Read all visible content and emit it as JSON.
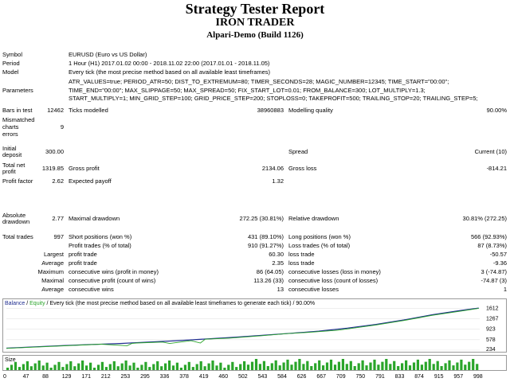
{
  "header": {
    "title": "Strategy Tester Report",
    "subtitle": "IRON TRADER",
    "server": "Alpari-Demo (Build 1126)"
  },
  "info": {
    "symbol_label": "Symbol",
    "symbol": "EURUSD (Euro vs US Dollar)",
    "period_label": "Period",
    "period": "1 Hour (H1) 2017.01.02 00:00 - 2018.11.02 22:00 (2017.01.01 - 2018.11.05)",
    "model_label": "Model",
    "model": "Every tick (the most precise method based on all available least timeframes)",
    "parameters_label": "Parameters",
    "parameters_line1": "ATR_VALUES=true; PERIOD_ATR=50; DIST_TO_EXTREMUM=80; TIMER_SECONDS=28; MAGIC_NUMBER=12345; TIME_START=\"00:00\";",
    "parameters_line2": "TIME_END=\"00:00\"; MAX_SLIPPAGE=50; MAX_SPREAD=50; FIX_START_LOT=0.01; FROM_BALANCE=300; LOT_MULTIPLY=1.3;",
    "parameters_line3": "START_MULTIPLY=1; MIN_GRID_STEP=100; GRID_PRICE_STEP=200; STOPLOSS=0; TAKEPROFIT=500; TRAILING_STOP=20; TRAILING_STEP=5;"
  },
  "stats": {
    "bars_label": "Bars in test",
    "bars": "12462",
    "ticks_label": "Ticks modelled",
    "ticks": "38960883",
    "quality_label": "Modelling quality",
    "quality": "90.00%",
    "mismatch_label1": "Mismatched",
    "mismatch_label2": "charts",
    "mismatch_label3": "errors",
    "mismatch": "9",
    "deposit_label1": "Initial",
    "deposit_label2": "deposit",
    "deposit": "300.00",
    "spread_label": "Spread",
    "spread": "Current (10)",
    "netprofit_label1": "Total net",
    "netprofit_label2": "profit",
    "netprofit": "1319.85",
    "grossprofit_label": "Gross profit",
    "grossprofit": "2134.06",
    "grossloss_label": "Gross loss",
    "grossloss": "-814.21",
    "pf_label": "Profit factor",
    "pf": "2.62",
    "payoff_label": "Expected payoff",
    "payoff": "1.32",
    "absdd_label1": "Absolute",
    "absdd_label2": "drawdown",
    "absdd": "2.77",
    "maxdd_label": "Maximal drawdown",
    "maxdd": "272.25 (30.81%)",
    "reldd_label": "Relative drawdown",
    "reldd": "30.81% (272.25)",
    "trades_label": "Total trades",
    "trades": "997",
    "short_label": "Short positions (won %)",
    "short": "431 (89.10%)",
    "long_label": "Long positions (won %)",
    "long": "566 (92.93%)",
    "ptrades_label": "Profit trades (% of total)",
    "ptrades": "910 (91.27%)",
    "ltrades_label": "Loss trades (% of total)",
    "ltrades": "87 (8.73%)",
    "largest_label": "Largest",
    "lprofit_label": "profit trade",
    "lprofit": "60.30",
    "lloss_label": "loss trade",
    "lloss": "-50.57",
    "average_label": "Average",
    "aprofit_label": "profit trade",
    "aprofit": "2.35",
    "aloss_label": "loss trade",
    "aloss": "-9.36",
    "maximum_label": "Maximum",
    "mcw_label": "consecutive wins (profit in money)",
    "mcw": "86 (64.05)",
    "mcl_label": "consecutive losses (loss in money)",
    "mcl": "3 (-74.87)",
    "maximal_label": "Maximal",
    "mcp_label": "consecutive profit (count of wins)",
    "mcp": "113.26 (33)",
    "mcll_label": "consecutive loss (count of losses)",
    "mcll": "-74.87 (3)",
    "average2_label": "Average",
    "acw_label": "consecutive wins",
    "acw": "13",
    "acl_label": "consecutive losses",
    "acl": "1"
  },
  "chart_legend": {
    "balance": "Balance",
    "sep1": " / ",
    "equity": "Equity",
    "rest": " / Every tick (the most precise method based on all available least timeframes to generate each tick) / 90.00%"
  },
  "chart_data": {
    "type": "line",
    "xlabel": "",
    "ylabel": "",
    "y_ticks": [
      "1612",
      "1267",
      "923",
      "578",
      "234"
    ],
    "x_ticks": [
      "0",
      "47",
      "88",
      "129",
      "171",
      "212",
      "253",
      "295",
      "336",
      "378",
      "419",
      "460",
      "502",
      "543",
      "584",
      "626",
      "667",
      "709",
      "750",
      "791",
      "833",
      "874",
      "915",
      "957",
      "998"
    ],
    "ylim": [
      234,
      1700
    ],
    "xlim": [
      0,
      1000
    ],
    "series": [
      {
        "name": "Balance",
        "color": "#1f2d8f",
        "x": [
          0,
          60,
          120,
          180,
          240,
          300,
          360,
          420,
          480,
          540,
          600,
          660,
          720,
          780,
          840,
          900,
          960,
          998
        ],
        "y": [
          300,
          345,
          385,
          420,
          455,
          500,
          545,
          600,
          655,
          720,
          790,
          860,
          960,
          1080,
          1230,
          1400,
          1540,
          1620
        ]
      },
      {
        "name": "Equity",
        "color": "#2aa52a",
        "x": [
          0,
          200,
          255,
          265,
          275,
          330,
          345,
          390,
          410,
          420,
          470,
          540,
          590,
          640,
          700,
          780,
          840,
          900,
          960,
          998
        ],
        "y": [
          295,
          430,
          380,
          455,
          470,
          500,
          455,
          545,
          470,
          595,
          630,
          710,
          775,
          820,
          890,
          1060,
          1210,
          1380,
          1520,
          1612
        ]
      }
    ],
    "size_title": "Size"
  }
}
